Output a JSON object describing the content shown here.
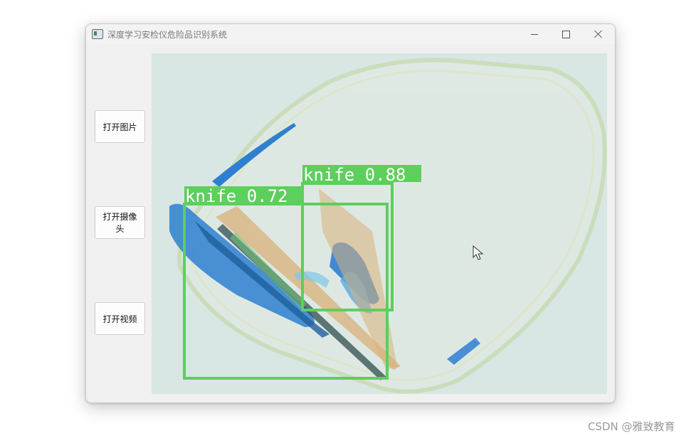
{
  "window": {
    "title": "深度学习安检仪危险品识别系统",
    "controls": [
      "minimize-icon",
      "maximize-icon",
      "close-icon"
    ]
  },
  "sidebar": {
    "buttons": [
      {
        "label": "打开图片"
      },
      {
        "label": "打开摄像头"
      },
      {
        "label": "打开视频"
      }
    ]
  },
  "detections": [
    {
      "label": "knife 0.88",
      "class": "knife",
      "confidence": 0.88
    },
    {
      "label": "knife 0.72",
      "class": "knife",
      "confidence": 0.72
    }
  ],
  "colors": {
    "box": "#5ccf5c",
    "box_text": "#ffffff",
    "xray_background": "#d8e6e4",
    "item_blue": "#2e7fd0",
    "item_orange": "#d8b07a"
  },
  "watermark": "CSDN @雅致教育"
}
